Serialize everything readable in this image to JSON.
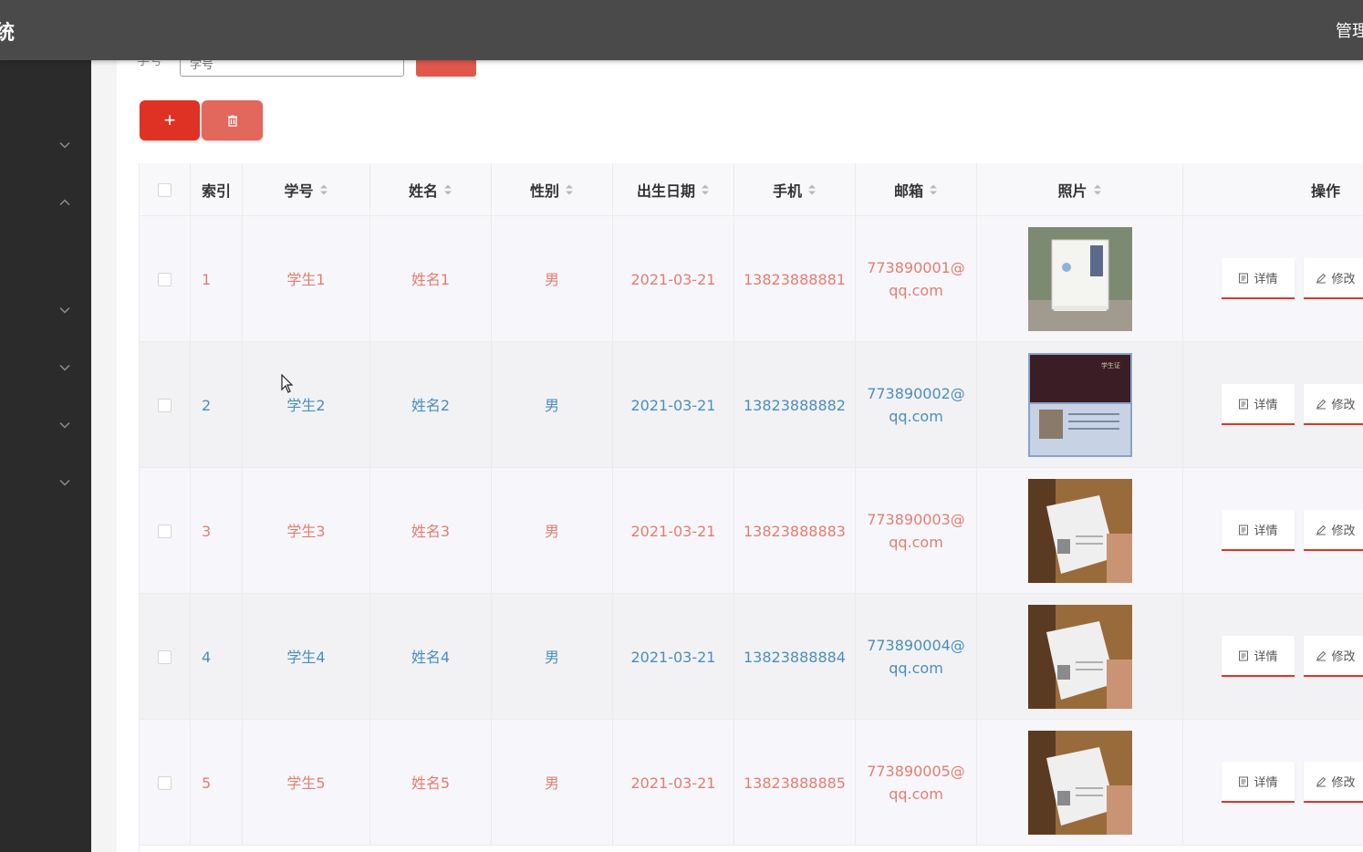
{
  "header": {
    "title_fragment": "统",
    "admin_fragment": "管理"
  },
  "sidebar": {
    "items": [
      {
        "icon": "chevron-down-icon"
      },
      {
        "icon": "chevron-up-icon"
      },
      {
        "icon": "chevron-down-icon"
      },
      {
        "icon": "chevron-down-icon"
      },
      {
        "icon": "chevron-down-icon"
      },
      {
        "icon": "chevron-down-icon"
      }
    ]
  },
  "search": {
    "label": "学号",
    "placeholder": "学号"
  },
  "toolbar": {
    "add_label": "+"
  },
  "table": {
    "columns": [
      {
        "key": "index",
        "label": "索引",
        "sortable": false
      },
      {
        "key": "student_no",
        "label": "学号",
        "sortable": true
      },
      {
        "key": "name",
        "label": "姓名",
        "sortable": true
      },
      {
        "key": "gender",
        "label": "性别",
        "sortable": true
      },
      {
        "key": "birthdate",
        "label": "出生日期",
        "sortable": true
      },
      {
        "key": "phone",
        "label": "手机",
        "sortable": true
      },
      {
        "key": "email",
        "label": "邮箱",
        "sortable": true
      },
      {
        "key": "photo",
        "label": "照片",
        "sortable": true
      },
      {
        "key": "actions",
        "label": "操作",
        "sortable": false
      }
    ],
    "rows": [
      {
        "index": "1",
        "student_no": "学生1",
        "name": "姓名1",
        "gender": "男",
        "birthdate": "2021-03-21",
        "phone": "13823888881",
        "email_line1": "773890001@",
        "email_line2": "qq.com"
      },
      {
        "index": "2",
        "student_no": "学生2",
        "name": "姓名2",
        "gender": "男",
        "birthdate": "2021-03-21",
        "phone": "13823888882",
        "email_line1": "773890002@",
        "email_line2": "qq.com"
      },
      {
        "index": "3",
        "student_no": "学生3",
        "name": "姓名3",
        "gender": "男",
        "birthdate": "2021-03-21",
        "phone": "13823888883",
        "email_line1": "773890003@",
        "email_line2": "qq.com"
      },
      {
        "index": "4",
        "student_no": "学生4",
        "name": "姓名4",
        "gender": "男",
        "birthdate": "2021-03-21",
        "phone": "13823888884",
        "email_line1": "773890004@",
        "email_line2": "qq.com"
      },
      {
        "index": "5",
        "student_no": "学生5",
        "name": "姓名5",
        "gender": "男",
        "birthdate": "2021-03-21",
        "phone": "13823888885",
        "email_line1": "773890005@",
        "email_line2": "qq.com"
      }
    ],
    "actions": {
      "detail_label": "详情",
      "edit_label": "修改"
    }
  },
  "colors": {
    "topbar": "#4b4a4b",
    "sidebar": "#2b2b2c",
    "primary_red": "#e03224",
    "row_text_red": "#e67c6e",
    "row_text_blue": "#4a8ec0"
  }
}
